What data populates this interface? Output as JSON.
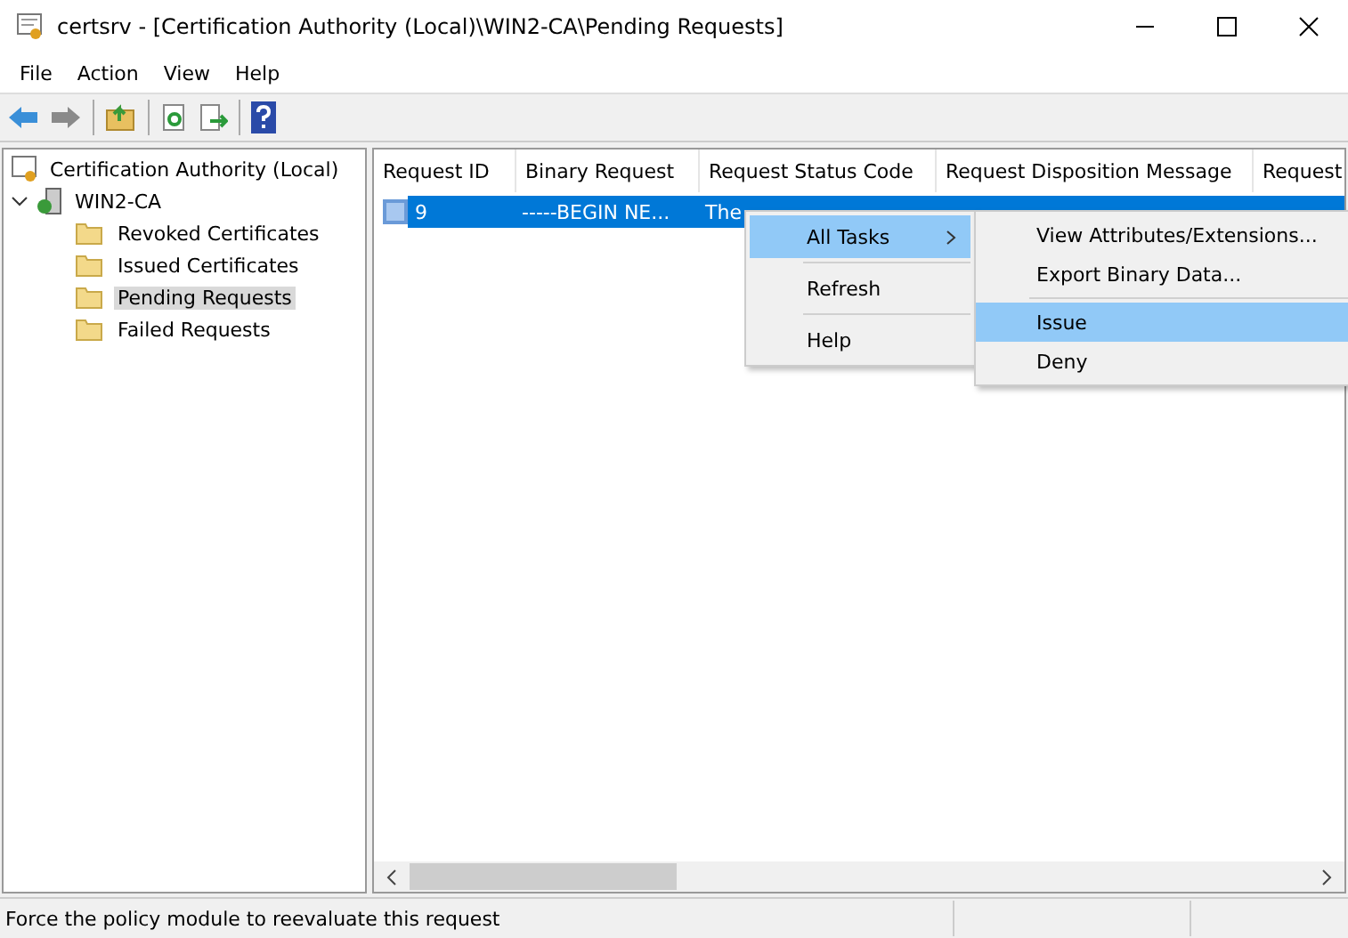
{
  "window": {
    "title": "certsrv - [Certification Authority (Local)\\WIN2-CA\\Pending Requests]"
  },
  "menu_bar": [
    "File",
    "Action",
    "View",
    "Help"
  ],
  "tree": {
    "label": "Certification Authority (Local)",
    "children": [
      {
        "label": "WIN2-CA",
        "expanded": true,
        "children": [
          {
            "label": "Revoked Certificates",
            "selected": false
          },
          {
            "label": "Issued Certificates",
            "selected": false
          },
          {
            "label": "Pending Requests",
            "selected": true
          },
          {
            "label": "Failed Requests",
            "selected": false
          }
        ]
      }
    ]
  },
  "table": {
    "columns": [
      "Request ID",
      "Binary Request",
      "Request Status Code",
      "Request Disposition Message",
      "Request"
    ],
    "rows": [
      {
        "selected": true,
        "cells": [
          "9",
          "-----BEGIN NE...",
          "The"
        ]
      }
    ]
  },
  "context_menu": {
    "items": [
      {
        "kind": "item",
        "label": "All Tasks",
        "submenu": true,
        "selected": true
      },
      {
        "kind": "separator"
      },
      {
        "kind": "item",
        "label": "Refresh",
        "submenu": false,
        "selected": false
      },
      {
        "kind": "separator"
      },
      {
        "kind": "item",
        "label": "Help",
        "submenu": false,
        "selected": false
      }
    ]
  },
  "submenu": {
    "items": [
      {
        "kind": "item",
        "label": "View Attributes/Extensions...",
        "selected": false
      },
      {
        "kind": "item",
        "label": "Export Binary Data...",
        "selected": false
      },
      {
        "kind": "separator"
      },
      {
        "kind": "item",
        "label": "Issue",
        "selected": true
      },
      {
        "kind": "item",
        "label": "Deny",
        "selected": false
      }
    ]
  },
  "status_bar": "Force the policy module to reevaluate this request"
}
